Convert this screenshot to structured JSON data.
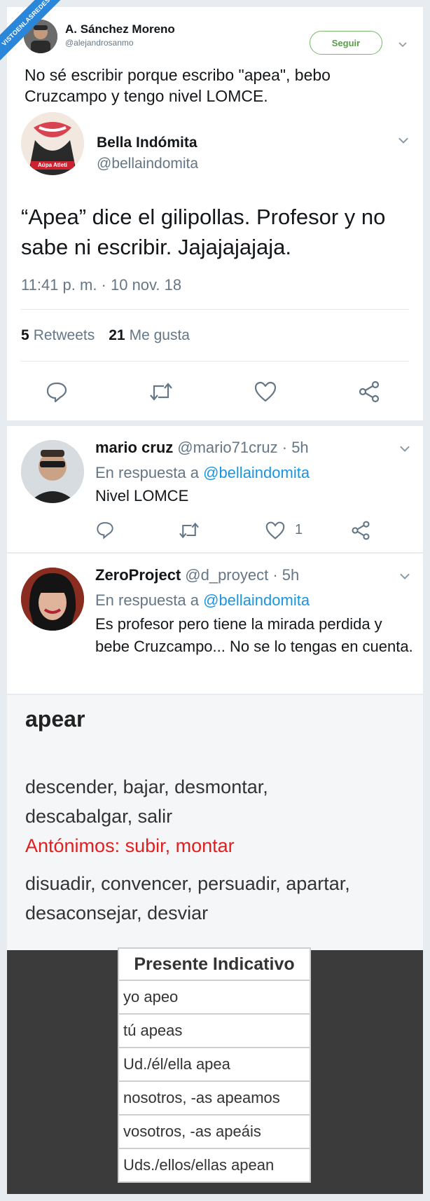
{
  "watermark": "VISTOENLASREDES",
  "top_tweet": {
    "author_name": "A. Sánchez Moreno",
    "author_handle": "@alejandrosanmo",
    "follow_label": "Seguir",
    "text": "No sé escribir porque escribo \"apea\", bebo Cruzcampo y tengo nivel LOMCE."
  },
  "quoted_tweet": {
    "author_name": "Bella Indómita",
    "author_handle": "@bellaindomita",
    "avatar_caption": "Aúpa Atleti",
    "text": "“Apea” dice el gilipollas. Profesor y no sabe ni escribir. Jajajajajaja.",
    "timestamp": "11:41 p. m. · 10 nov. 18",
    "retweets_count": "5",
    "retweets_label": "Retweets",
    "likes_count": "21",
    "likes_label": "Me gusta"
  },
  "replies": [
    {
      "name": "mario cruz",
      "handle_time": "@mario71cruz · 5h",
      "reply_prefix": "En respuesta a",
      "reply_to": "@bellaindomita",
      "text": "Nivel LOMCE",
      "like_count": "1"
    },
    {
      "name": "ZeroProject",
      "handle_time": "@d_proyect · 5h",
      "reply_prefix": "En respuesta a",
      "reply_to": "@bellaindomita",
      "text": "Es profesor pero tiene la mirada perdida y bebe Cruzcampo... No se lo tengas en cuenta."
    }
  ],
  "dictionary": {
    "word": "apear",
    "synonyms_1": "descender, bajar, desmontar, descabalgar, salir",
    "antonyms": "Antónimos: subir, montar",
    "synonyms_2": "disuadir, convencer, persuadir, apartar, desaconsejar, desviar"
  },
  "conjugation": {
    "header": "Presente Indicativo",
    "rows": [
      "yo apeo",
      "tú apeas",
      "Ud./él/ella apea",
      "nosotros, -as apeamos",
      "vosotros, -as apeáis",
      "Uds./ellos/ellas apean"
    ]
  },
  "colors": {
    "accent": "#1b95e0",
    "follow_green": "#56a047",
    "antonym_red": "#e02020",
    "dark_bg": "#3b3b3b"
  }
}
